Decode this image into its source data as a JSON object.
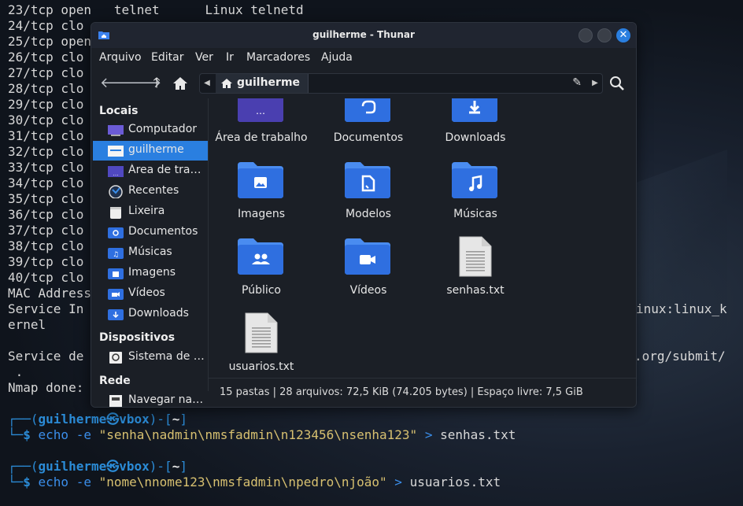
{
  "terminal": {
    "lines": [
      "23/tcp open   telnet      Linux telnetd",
      "24/tcp clo",
      "25/tcp open",
      "26/tcp clo",
      "27/tcp clo",
      "28/tcp clo",
      "29/tcp clo",
      "30/tcp clo",
      "31/tcp clo",
      "32/tcp clo",
      "33/tcp clo",
      "34/tcp clo",
      "35/tcp clo",
      "36/tcp clo",
      "37/tcp clo",
      "38/tcp clo",
      "39/tcp clo",
      "40/tcp clo",
      "MAC Address",
      "Service In",
      "ernel",
      "",
      "Service de",
      " .",
      "Nmap done:"
    ],
    "right_fragments": [
      {
        "text": "inux:linux_k"
      },
      {
        "text": ".org/submit/"
      }
    ],
    "prompts": [
      {
        "user": "guilherme",
        "at": "㉿",
        "host": "vbox",
        "dir": "~",
        "cmd": "echo",
        "flag": "-e",
        "arg": "\"senha\\nadmin\\nmsfadmin\\n123456\\nsenha123\"",
        "redir": ">",
        "file": "senhas.txt"
      },
      {
        "user": "guilherme",
        "at": "㉿",
        "host": "vbox",
        "dir": "~",
        "cmd": "echo",
        "flag": "-e",
        "arg": "\"nome\\nnome123\\nmsfadmin\\npedro\\njoão\"",
        "redir": ">",
        "file": "usuarios.txt"
      }
    ]
  },
  "thunar": {
    "title": "guilherme - Thunar",
    "close_glyph": "✕",
    "menu": [
      "Arquivo",
      "Editar",
      "Ver",
      "Ir",
      "Marcadores",
      "Ajuda"
    ],
    "path": {
      "current": "guilherme"
    },
    "sidebar": {
      "sections": [
        {
          "title": "Locais"
        },
        {
          "title": "Dispositivos"
        },
        {
          "title": "Rede"
        }
      ],
      "places": [
        {
          "label": "Computador",
          "icon": "computer-icon"
        },
        {
          "label": "guilherme",
          "icon": "home-folder-icon",
          "selected": true
        },
        {
          "label": "Área de trabalho",
          "icon": "desktop-icon"
        },
        {
          "label": "Recentes",
          "icon": "recent-icon"
        },
        {
          "label": "Lixeira",
          "icon": "trash-icon"
        },
        {
          "label": "Documentos",
          "icon": "documents-folder-icon"
        },
        {
          "label": "Músicas",
          "icon": "music-folder-icon"
        },
        {
          "label": "Imagens",
          "icon": "pictures-folder-icon"
        },
        {
          "label": "Vídeos",
          "icon": "videos-folder-icon"
        },
        {
          "label": "Downloads",
          "icon": "downloads-folder-icon"
        }
      ],
      "devices": [
        {
          "label": "Sistema de arquivos",
          "icon": "drive-icon"
        }
      ],
      "network": [
        {
          "label": "Navegar na rede",
          "icon": "network-icon"
        }
      ]
    },
    "files": [
      {
        "label": "Área de trabalho",
        "icon": "desktop-folder-icon"
      },
      {
        "label": "Documentos",
        "icon": "documents-folder-icon"
      },
      {
        "label": "Downloads",
        "icon": "downloads-folder-icon"
      },
      {
        "label": "Imagens",
        "icon": "pictures-folder-icon"
      },
      {
        "label": "Modelos",
        "icon": "templates-folder-icon"
      },
      {
        "label": "Músicas",
        "icon": "music-folder-icon"
      },
      {
        "label": "Público",
        "icon": "public-folder-icon"
      },
      {
        "label": "Vídeos",
        "icon": "videos-folder-icon"
      },
      {
        "label": "senhas.txt",
        "icon": "text-file-icon"
      },
      {
        "label": "usuarios.txt",
        "icon": "text-file-icon"
      }
    ],
    "status": "15 pastas  |  28 arquivos: 72,5 KiB (74.205 bytes)  |  Espaço livre: 7,5 GiB",
    "colors": {
      "accent": "#2a7fe0",
      "folder": "#2f6fe0",
      "folder_tab": "#4a8cf0"
    }
  }
}
